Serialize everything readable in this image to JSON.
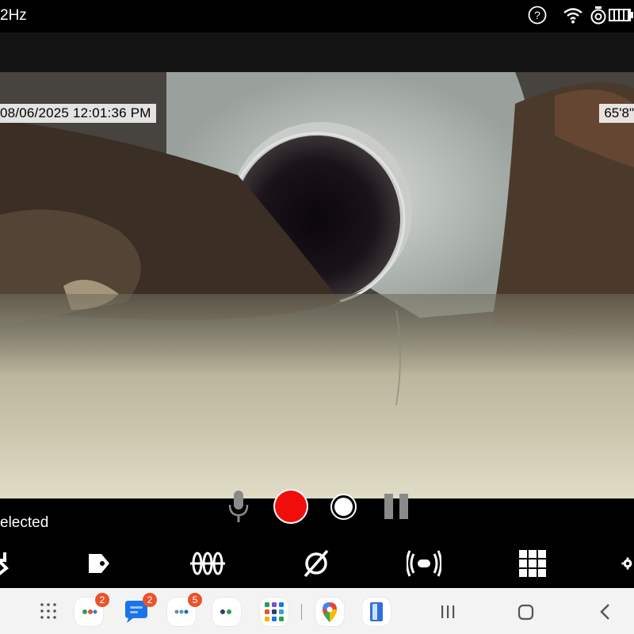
{
  "status_bar": {
    "left_text": "2Hz",
    "icons": [
      "help-icon",
      "wifi-icon",
      "camera-battery-icon",
      "battery-icon"
    ]
  },
  "camera": {
    "timestamp": "08/06/2025  12:01:36 PM",
    "distance": "65'8\""
  },
  "controls": {
    "selection_text": "elected",
    "buttons": [
      "microphone-icon",
      "record-button",
      "snapshot-button",
      "pause-icon"
    ]
  },
  "tool_row": {
    "items": [
      "back-arrow-icon",
      "tag-icon",
      "waveform-icon",
      "no-diameter-icon",
      "sonde-icon",
      "grid-icon",
      "settings-icon"
    ]
  },
  "nav_bar": {
    "apps": [
      {
        "name": "app-folder-1",
        "badge": "2"
      },
      {
        "name": "messages-app",
        "badge": "2"
      },
      {
        "name": "app-folder-2",
        "badge": "5"
      },
      {
        "name": "app-folder-3",
        "badge": ""
      },
      {
        "name": "app-folder-4",
        "badge": ""
      },
      {
        "name": "maps-app",
        "badge": ""
      },
      {
        "name": "door-app",
        "badge": ""
      }
    ]
  },
  "colors": {
    "record": "#f20d0d",
    "badge": "#e8542c",
    "background": "#000000",
    "nav_bar": "#f3f3f3"
  }
}
